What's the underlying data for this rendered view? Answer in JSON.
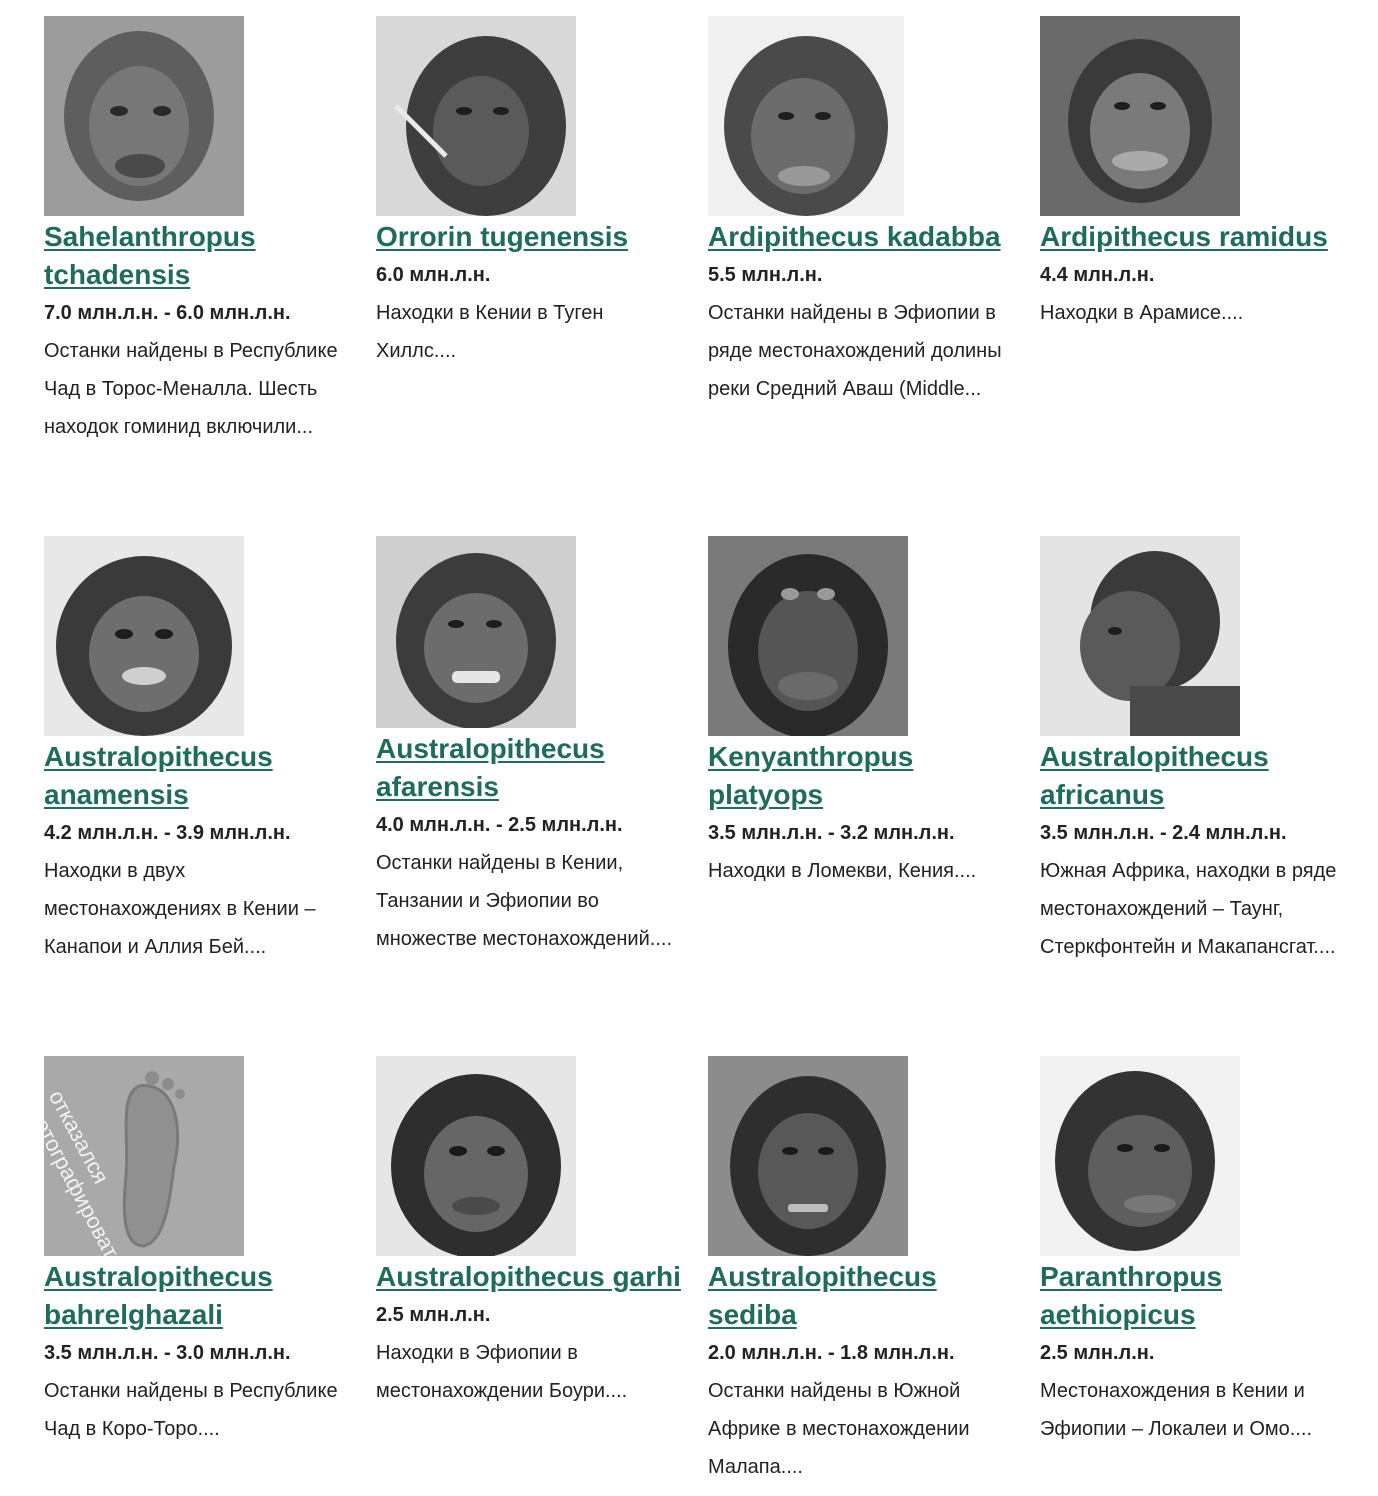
{
  "colors": {
    "link": "#1f6b5c",
    "text": "#222222"
  },
  "cards": [
    {
      "title": "Sahelanthropus tchadensis",
      "date": "7.0 млн.л.н. - 6.0 млн.л.н.",
      "desc": "Останки найдены в Республике Чад в Торос-Меналла.  Шесть находок гоминид включили..."
    },
    {
      "title": "Orrorin tugenensis",
      "date": "6.0 млн.л.н.",
      "desc": "Находки в Кении в Туген Хиллс...."
    },
    {
      "title": "Ardipithecus kadabba",
      "date": "5.5 млн.л.н.",
      "desc": "Останки найдены в Эфиопии в ряде местонахождений долины реки Средний Аваш (Middle..."
    },
    {
      "title": "Ardipithecus ramidus",
      "date": "4.4 млн.л.н.",
      "desc": "Находки в Арамисе...."
    },
    {
      "title": "Australopithecus anamensis",
      "date": "4.2 млн.л.н. - 3.9 млн.л.н.",
      "desc": "Находки в двух местонахождениях в Кении – Канапои и Аллия Бей...."
    },
    {
      "title": "Australopithecus afarensis",
      "date": "4.0 млн.л.н. - 2.5 млн.л.н.",
      "desc": "Останки найдены в Кении, Танзании и Эфиопии во множестве местонахождений...."
    },
    {
      "title": "Kenyanthropus platyops",
      "date": "3.5 млн.л.н. - 3.2 млн.л.н.",
      "desc": "Находки в Ломекви, Кения...."
    },
    {
      "title": "Australopithecus africanus",
      "date": "3.5 млн.л.н. - 2.4 млн.л.н.",
      "desc": "Южная Африка, находки в ряде местонахождений – Таунг, Стеркфонтейн и Макапансгат...."
    },
    {
      "title": "Australopithecus bahrelghazali",
      "date": "3.5 млн.л.н. - 3.0 млн.л.н.",
      "desc": "Останки найдены в Республике Чад в Коро-Торо....",
      "image_text": "отказался фотографироваться"
    },
    {
      "title": "Australopithecus garhi",
      "date": "2.5 млн.л.н.",
      "desc": "Находки в Эфиопии в местонахождении Боури...."
    },
    {
      "title": "Australopithecus sediba",
      "date": "2.0 млн.л.н. - 1.8 млн.л.н.",
      "desc": "Останки найдены в Южной Африке в  местонахождении Малапа...."
    },
    {
      "title": "Paranthropus aethiopicus",
      "date": "2.5 млн.л.н.",
      "desc": "Местонахождения в Кении и Эфиопии – Локалеи и Омо...."
    }
  ]
}
